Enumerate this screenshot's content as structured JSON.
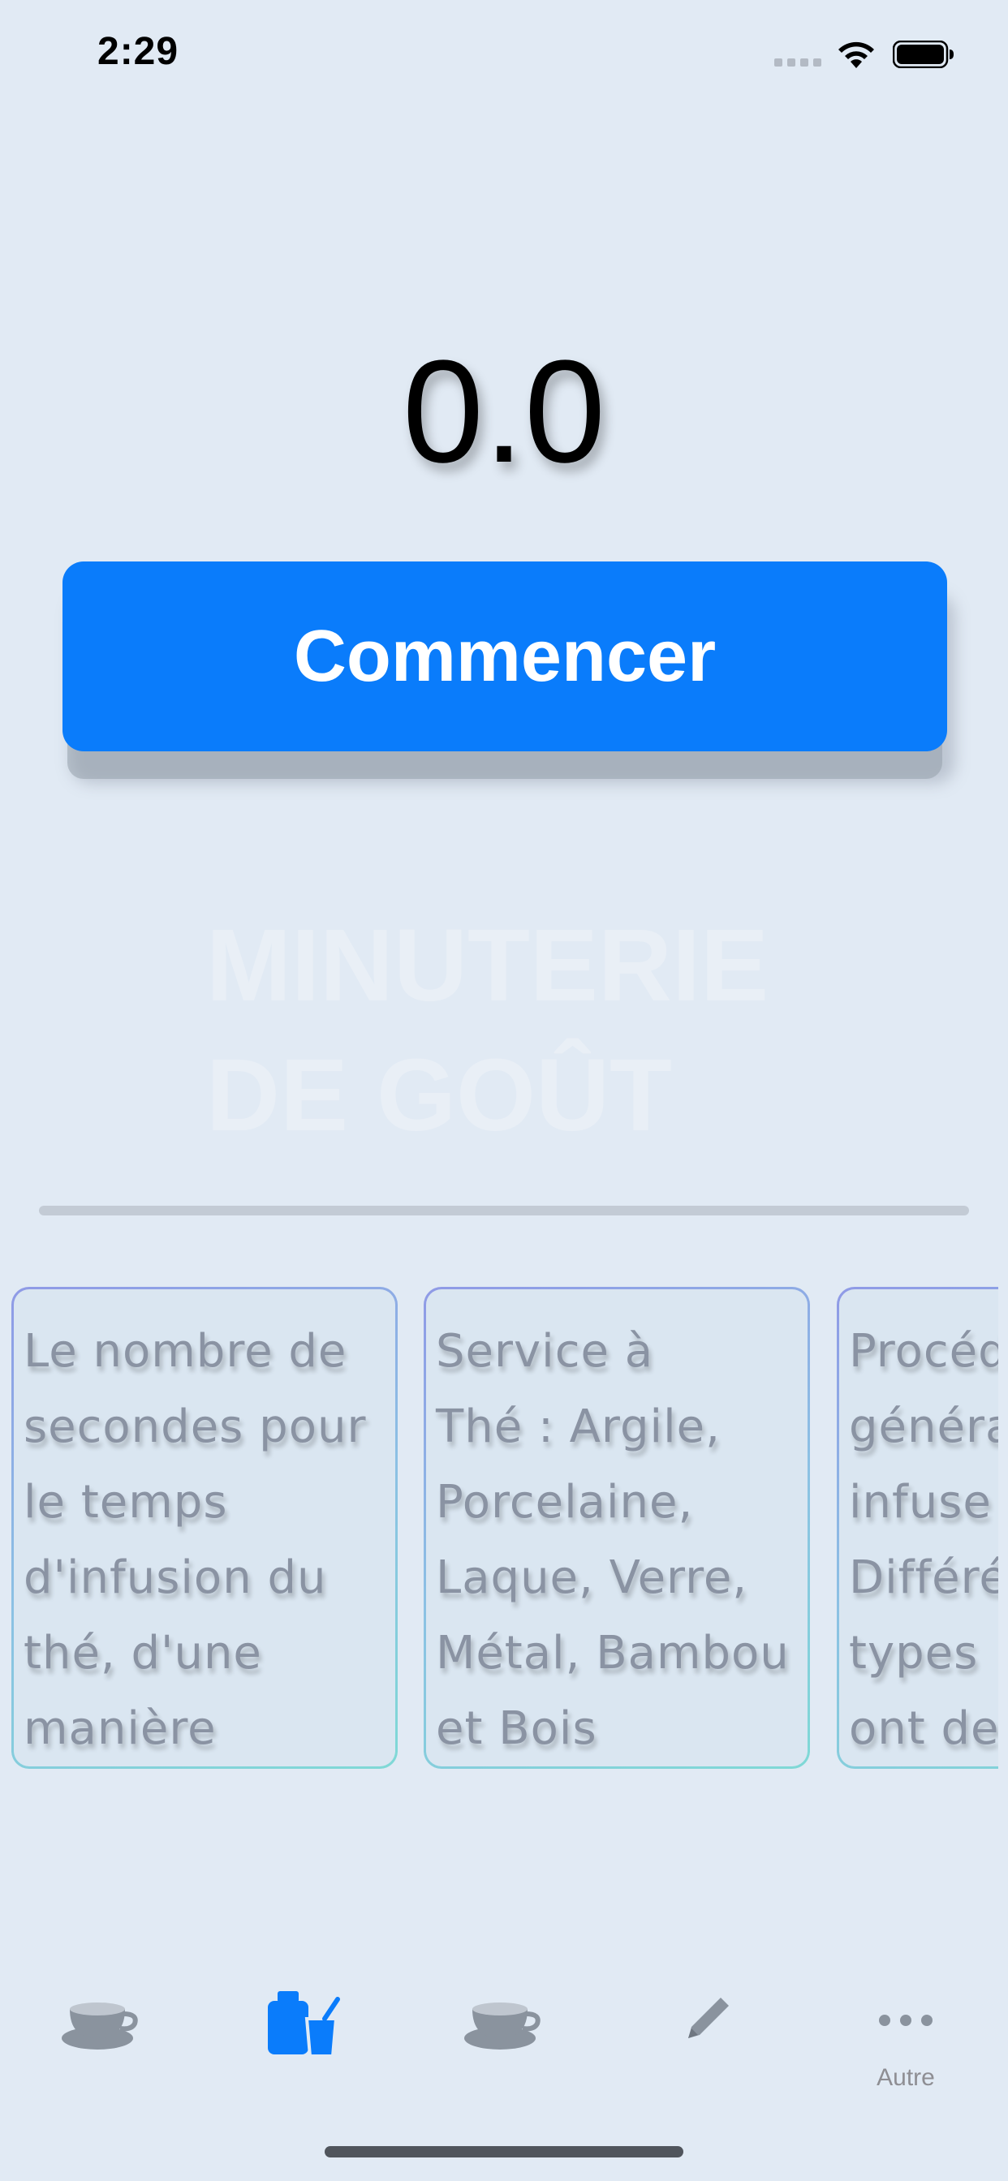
{
  "status_bar": {
    "time": "2:29"
  },
  "timer": {
    "value": "0.0"
  },
  "start_button": {
    "label": "Commencer",
    "color": "#0a7cfb"
  },
  "watermark": {
    "line1": "MINUTERIE",
    "line2": "DE GOÛT"
  },
  "cards": [
    {
      "text": "Le nombre de\nsecondes pour\nle temps\nd'infusion du\nthé, d'une\nmanière"
    },
    {
      "text": "Service à\nThé : Argile,\nPorcelaine,\nLaque, Verre,\nMétal, Bambou\net Bois"
    },
    {
      "text": "Procéd\ngénéra\ninfuse\nDifféré\ntypes\nont de"
    }
  ],
  "tab_bar": {
    "items": [
      {
        "icon": "teacup-icon",
        "label": "",
        "active": false
      },
      {
        "icon": "tea-bag-cup-icon",
        "label": "",
        "active": true
      },
      {
        "icon": "teacup-icon",
        "label": "",
        "active": false
      },
      {
        "icon": "pencil-icon",
        "label": "",
        "active": false
      },
      {
        "icon": "more-icon",
        "label": "Autre",
        "active": false
      }
    ],
    "active_color": "#0a7cfb",
    "inactive_color": "#8e8e93"
  }
}
